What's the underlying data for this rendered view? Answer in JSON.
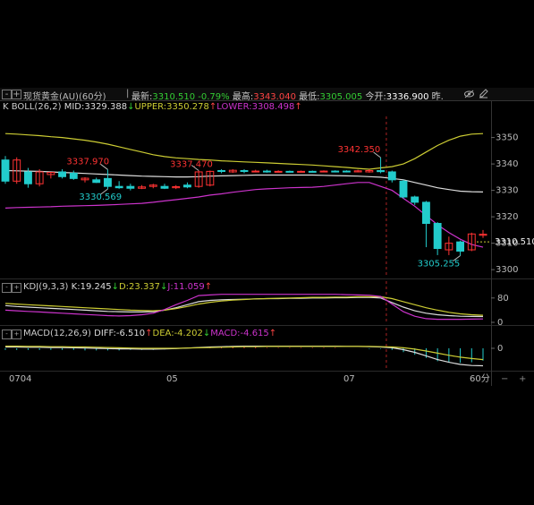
{
  "header": {
    "symbol": "现货黄金(AU)(60分)",
    "quote": "最新:3310.510 -0.79% 最高:3343.040 最低:3305.005 今开:3336.900 昨..",
    "quote_parts": [
      {
        "text": "最新:",
        "color": "#cccccc"
      },
      {
        "text": "3310.510 -0.79%",
        "color": "#33cc33"
      },
      {
        "text": " 最高:",
        "color": "#cccccc"
      },
      {
        "text": "3343.040",
        "color": "#ff4444"
      },
      {
        "text": " 最低:",
        "color": "#cccccc"
      },
      {
        "text": "3305.005",
        "color": "#33cc33"
      },
      {
        "text": " 今开:",
        "color": "#cccccc"
      },
      {
        "text": "3336.900",
        "color": "#ffffff"
      },
      {
        "text": " 昨.",
        "color": "#cccccc"
      }
    ]
  },
  "indicators": {
    "boll": {
      "name": "K BOLL(26,2)",
      "mid": "MID:3329.388",
      "upper": "UPPER:3350.278",
      "lower": "LOWER:3308.498"
    },
    "kdj": {
      "name": "KDJ(9,3,3)",
      "k": "K:19.245",
      "d": "D:23.337",
      "j": "J:11.059"
    },
    "macd": {
      "name": "MACD(12,26,9)",
      "diff": "DIFF:-6.510",
      "dea": "DEA:-4.202",
      "macd": "MACD:-4.615"
    }
  },
  "colors": {
    "up": "#ff3333",
    "down": "#22cccc",
    "mid": "#dddddd",
    "upper": "#cccc33",
    "lower": "#cc33cc",
    "k": "#dddddd",
    "d": "#cccc33",
    "j": "#cc33cc"
  },
  "chart_data": {
    "type": "candlestick",
    "price_ticks": [
      "3350",
      "3340",
      "3330",
      "3320",
      "3310",
      "3300"
    ],
    "price_range": [
      3297,
      3358
    ],
    "last_price_label": "3310.510",
    "annotations": [
      "3337.970",
      "3337.470",
      "3330.569",
      "3342.350",
      "3305.255"
    ],
    "x_labels": [
      "0704",
      "05",
      "07",
      "60分"
    ],
    "kdj_ticks": [
      "80",
      "0"
    ],
    "macd_ticks": [
      "0"
    ],
    "candles": [
      {
        "o": 3341.5,
        "c": 3333.5,
        "h": 3343.0,
        "l": 3332.5
      },
      {
        "o": 3333.5,
        "c": 3341.5,
        "h": 3342.5,
        "l": 3332.5
      },
      {
        "o": 3337.0,
        "c": 3332.5,
        "h": 3338.5,
        "l": 3331.0
      },
      {
        "o": 3332.5,
        "c": 3337.0,
        "h": 3338.0,
        "l": 3331.5
      },
      {
        "o": 3336.0,
        "c": 3336.8,
        "h": 3337.0,
        "l": 3334.5
      },
      {
        "o": 3337.0,
        "c": 3335.2,
        "h": 3338.0,
        "l": 3334.5
      },
      {
        "o": 3336.5,
        "c": 3334.5,
        "h": 3337.5,
        "l": 3334.0
      },
      {
        "o": 3334.0,
        "c": 3334.6,
        "h": 3335.0,
        "l": 3333.0
      },
      {
        "o": 3334.0,
        "c": 3333.0,
        "h": 3334.8,
        "l": 3332.8
      },
      {
        "o": 3334.5,
        "c": 3331.5,
        "h": 3337.9,
        "l": 3330.5
      },
      {
        "o": 3331.5,
        "c": 3331.0,
        "h": 3333.5,
        "l": 3330.6
      },
      {
        "o": 3331.5,
        "c": 3330.8,
        "h": 3332.5,
        "l": 3330.0
      },
      {
        "o": 3330.8,
        "c": 3331.3,
        "h": 3332.0,
        "l": 3330.5
      },
      {
        "o": 3331.5,
        "c": 3332.0,
        "h": 3332.5,
        "l": 3330.8
      },
      {
        "o": 3331.5,
        "c": 3330.8,
        "h": 3332.5,
        "l": 3330.5
      },
      {
        "o": 3331.0,
        "c": 3331.4,
        "h": 3332.0,
        "l": 3330.5
      },
      {
        "o": 3332.0,
        "c": 3331.3,
        "h": 3333.0,
        "l": 3330.8
      },
      {
        "o": 3331.5,
        "c": 3337.0,
        "h": 3337.5,
        "l": 3331.0
      },
      {
        "o": 3332.0,
        "c": 3337.2,
        "h": 3337.5,
        "l": 3331.5
      },
      {
        "o": 3337.5,
        "c": 3337.2,
        "h": 3338.0,
        "l": 3336.5
      },
      {
        "o": 3337.0,
        "c": 3337.6,
        "h": 3338.0,
        "l": 3336.6
      },
      {
        "o": 3337.5,
        "c": 3337.2,
        "h": 3338.0,
        "l": 3336.5
      },
      {
        "o": 3337.2,
        "c": 3337.3,
        "h": 3337.8,
        "l": 3336.8
      },
      {
        "o": 3337.3,
        "c": 3337.1,
        "h": 3337.8,
        "l": 3336.7
      },
      {
        "o": 3337.2,
        "c": 3337.2,
        "h": 3337.6,
        "l": 3336.9
      },
      {
        "o": 3337.2,
        "c": 3337.1,
        "h": 3337.5,
        "l": 3336.8
      },
      {
        "o": 3337.1,
        "c": 3337.2,
        "h": 3337.5,
        "l": 3336.8
      },
      {
        "o": 3337.2,
        "c": 3337.0,
        "h": 3337.5,
        "l": 3336.8
      },
      {
        "o": 3337.2,
        "c": 3337.3,
        "h": 3337.6,
        "l": 3336.9
      },
      {
        "o": 3337.3,
        "c": 3337.0,
        "h": 3337.6,
        "l": 3336.8
      },
      {
        "o": 3337.3,
        "c": 3337.1,
        "h": 3337.6,
        "l": 3336.8
      },
      {
        "o": 3337.0,
        "c": 3337.4,
        "h": 3337.8,
        "l": 3336.8
      },
      {
        "o": 3337.0,
        "c": 3337.5,
        "h": 3338.0,
        "l": 3336.7
      },
      {
        "o": 3337.5,
        "c": 3337.1,
        "h": 3342.4,
        "l": 3336.5
      },
      {
        "o": 3337.0,
        "c": 3334.0,
        "h": 3337.5,
        "l": 3333.0
      },
      {
        "o": 3333.5,
        "c": 3327.5,
        "h": 3334.0,
        "l": 3327.0
      },
      {
        "o": 3327.5,
        "c": 3325.5,
        "h": 3328.0,
        "l": 3324.5
      },
      {
        "o": 3325.5,
        "c": 3317.5,
        "h": 3326.0,
        "l": 3308.5
      },
      {
        "o": 3317.5,
        "c": 3308.0,
        "h": 3318.0,
        "l": 3305.5
      },
      {
        "o": 3307.5,
        "c": 3310.0,
        "h": 3312.5,
        "l": 3305.5
      },
      {
        "o": 3310.5,
        "c": 3307.0,
        "h": 3311.0,
        "l": 3305.3
      },
      {
        "o": 3307.5,
        "c": 3313.5,
        "h": 3314.0,
        "l": 3307.0
      },
      {
        "o": 3313.0,
        "c": 3313.4,
        "h": 3315.0,
        "l": 3312.0
      }
    ],
    "boll_upper": [
      3351.5,
      3351.3,
      3351.0,
      3350.7,
      3350.3,
      3350.0,
      3349.5,
      3349.0,
      3348.3,
      3347.5,
      3346.5,
      3345.5,
      3344.5,
      3343.5,
      3342.8,
      3342.3,
      3342.0,
      3341.7,
      3341.5,
      3341.2,
      3341.0,
      3340.8,
      3340.6,
      3340.4,
      3340.2,
      3340.0,
      3339.8,
      3339.6,
      3339.3,
      3339.0,
      3338.7,
      3338.3,
      3338.0,
      3338.5,
      3339.0,
      3340.0,
      3342.0,
      3344.5,
      3347.0,
      3349.0,
      3350.5,
      3351.3,
      3351.5
    ],
    "boll_mid": [
      3337.5,
      3337.4,
      3337.3,
      3337.2,
      3337.0,
      3336.8,
      3336.6,
      3336.4,
      3336.2,
      3336.0,
      3335.8,
      3335.6,
      3335.4,
      3335.3,
      3335.2,
      3335.1,
      3335.1,
      3335.2,
      3335.4,
      3335.5,
      3335.6,
      3335.7,
      3335.8,
      3335.8,
      3335.8,
      3335.8,
      3335.8,
      3335.8,
      3335.7,
      3335.6,
      3335.5,
      3335.4,
      3335.2,
      3335.0,
      3334.5,
      3334.0,
      3333.0,
      3332.0,
      3331.0,
      3330.3,
      3329.7,
      3329.5,
      3329.4
    ],
    "boll_lower": [
      3323.3,
      3323.5,
      3323.6,
      3323.7,
      3323.8,
      3324.0,
      3324.1,
      3324.2,
      3324.3,
      3324.5,
      3324.7,
      3324.9,
      3325.1,
      3325.5,
      3326.0,
      3326.5,
      3327.0,
      3327.5,
      3328.2,
      3328.7,
      3329.3,
      3329.8,
      3330.3,
      3330.6,
      3330.8,
      3331.0,
      3331.1,
      3331.2,
      3331.5,
      3332.0,
      3332.5,
      3333.0,
      3333.0,
      3331.5,
      3330.0,
      3327.0,
      3324.0,
      3320.5,
      3317.0,
      3314.0,
      3311.5,
      3309.5,
      3308.5
    ],
    "kdj_range": [
      0,
      100
    ],
    "kdj_k": [
      55,
      52,
      50,
      48,
      46,
      44,
      42,
      40,
      38,
      36,
      35,
      34,
      34,
      35,
      40,
      48,
      58,
      68,
      72,
      74,
      75,
      76,
      77,
      78,
      78,
      79,
      79,
      80,
      80,
      81,
      81,
      82,
      82,
      80,
      65,
      50,
      38,
      30,
      25,
      22,
      20,
      19.5,
      19.2
    ],
    "kdj_d": [
      62,
      60,
      58,
      56,
      54,
      52,
      50,
      48,
      46,
      44,
      42,
      40,
      39,
      38,
      40,
      45,
      52,
      60,
      66,
      70,
      73,
      75,
      77,
      78,
      79,
      80,
      81,
      82,
      82,
      83,
      83,
      84,
      84,
      84,
      78,
      68,
      58,
      48,
      40,
      33,
      28,
      25,
      23.3
    ],
    "kdj_j": [
      40,
      38,
      36,
      34,
      32,
      30,
      28,
      26,
      24,
      22,
      21,
      22,
      25,
      30,
      42,
      58,
      72,
      88,
      90,
      92,
      92,
      92,
      92,
      92,
      92,
      92,
      92,
      92,
      92,
      92,
      91,
      90,
      89,
      85,
      60,
      35,
      20,
      12,
      10,
      10,
      10,
      10.5,
      11.1
    ],
    "macd_range": [
      -8,
      3
    ],
    "macd_diff": [
      0.5,
      0.5,
      0.4,
      0.4,
      0.3,
      0.3,
      0.2,
      0.1,
      0.0,
      -0.1,
      -0.2,
      -0.2,
      -0.3,
      -0.3,
      -0.2,
      -0.1,
      0.1,
      0.3,
      0.5,
      0.6,
      0.7,
      0.8,
      0.8,
      0.8,
      0.8,
      0.8,
      0.8,
      0.8,
      0.8,
      0.8,
      0.7,
      0.7,
      0.6,
      0.5,
      0.2,
      -0.5,
      -1.5,
      -2.8,
      -4.2,
      -5.2,
      -6.0,
      -6.4,
      -6.5
    ],
    "macd_dea": [
      0.8,
      0.8,
      0.7,
      0.7,
      0.6,
      0.6,
      0.5,
      0.5,
      0.4,
      0.3,
      0.2,
      0.1,
      0.0,
      0.0,
      0.0,
      0.0,
      0.1,
      0.2,
      0.3,
      0.4,
      0.5,
      0.6,
      0.6,
      0.7,
      0.7,
      0.7,
      0.7,
      0.7,
      0.7,
      0.7,
      0.7,
      0.7,
      0.7,
      0.6,
      0.5,
      0.2,
      -0.3,
      -1.0,
      -1.8,
      -2.6,
      -3.3,
      -3.8,
      -4.2
    ],
    "macd_hist": [
      -0.6,
      -0.6,
      -0.6,
      -0.6,
      -0.6,
      -0.6,
      -0.6,
      -0.8,
      -0.8,
      -0.8,
      -0.8,
      -0.6,
      -0.6,
      -0.6,
      -0.4,
      -0.2,
      0.0,
      0.2,
      0.4,
      0.4,
      0.4,
      0.4,
      0.4,
      0.2,
      0.2,
      0.2,
      0.2,
      0.2,
      0.2,
      0.2,
      0.0,
      0.0,
      -0.2,
      -0.2,
      -0.6,
      -1.4,
      -2.4,
      -3.6,
      -4.8,
      -5.2,
      -5.4,
      -5.2,
      -4.6
    ]
  }
}
